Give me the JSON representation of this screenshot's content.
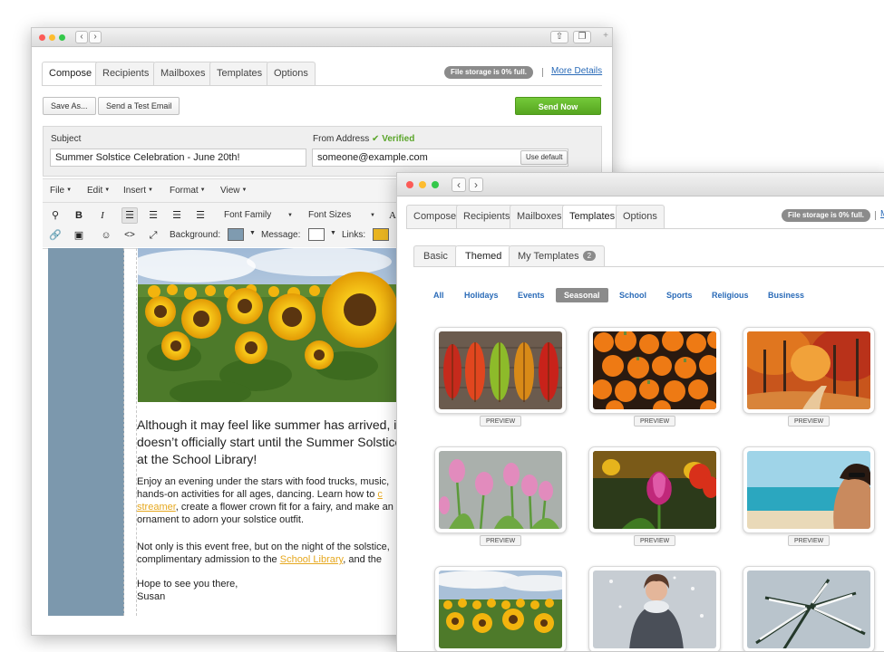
{
  "composer": {
    "tabs": [
      "Compose",
      "Recipients",
      "Mailboxes",
      "Templates",
      "Options"
    ],
    "active_tab": "Compose",
    "storage": "File storage is 0% full.",
    "more_details": "More Details",
    "save_as": "Save As...",
    "send_test": "Send a Test Email",
    "send_now": "Send Now",
    "subject_label": "Subject",
    "subject_value": "Summer Solstice Celebration - June 20th!",
    "from_label": "From Address",
    "verified": "Verified",
    "from_value": "someone@example.com",
    "use_default": "Use default",
    "menus": [
      "File",
      "Edit",
      "Insert",
      "Format",
      "View"
    ],
    "font_family": "Font Family",
    "font_sizes": "Font Sizes",
    "background_label": "Background:",
    "message_label": "Message:",
    "links_label": "Links:",
    "colors": {
      "background": "#7f9bb0",
      "message": "#ffffff",
      "links": "#e8b421",
      "sidebar": "#7c98ad",
      "send": "#62b32a"
    },
    "headline": "Although it may feel like summer has arrived, it doesn’t officially start until the Summer Solstice at the School Library!",
    "p1_a": "Enjoy an evening under the stars with food trucks, music, hands-on activities for all ages, dancing. Learn how to ",
    "p1_link1": "c",
    "p1_link2": "streamer",
    "p1_b": ", create a flower crown fit for a fairy, and make an ornament to adorn your solstice outfit.",
    "p2_a": "Not only is this event free, but on the night of the solstice, complimentary admission to the ",
    "p2_link": "School Library",
    "p2_b": ", and the",
    "p3_line1": "Hope to see you there,",
    "p3_line2": "Susan"
  },
  "templates_window": {
    "tabs": [
      "Compose",
      "Recipients",
      "Mailboxes",
      "Templates",
      "Options"
    ],
    "active_tab": "Templates",
    "storage": "File storage is 0% full.",
    "more_details_partial": "M",
    "subtabs": [
      "Basic",
      "Themed",
      "My Templates"
    ],
    "active_subtab": "Themed",
    "my_templates_count": "2",
    "filters": [
      "All",
      "Holidays",
      "Events",
      "Seasonal",
      "School",
      "Sports",
      "Religious",
      "Business"
    ],
    "active_filter": "Seasonal",
    "preview_label": "PREVIEW",
    "thumbnails": [
      "autumn-leaves",
      "pumpkins",
      "autumn-forest",
      "pink-tulips",
      "tulip-field",
      "beach-woman",
      "sunflowers",
      "snow-girl",
      "snowy-pine"
    ]
  }
}
